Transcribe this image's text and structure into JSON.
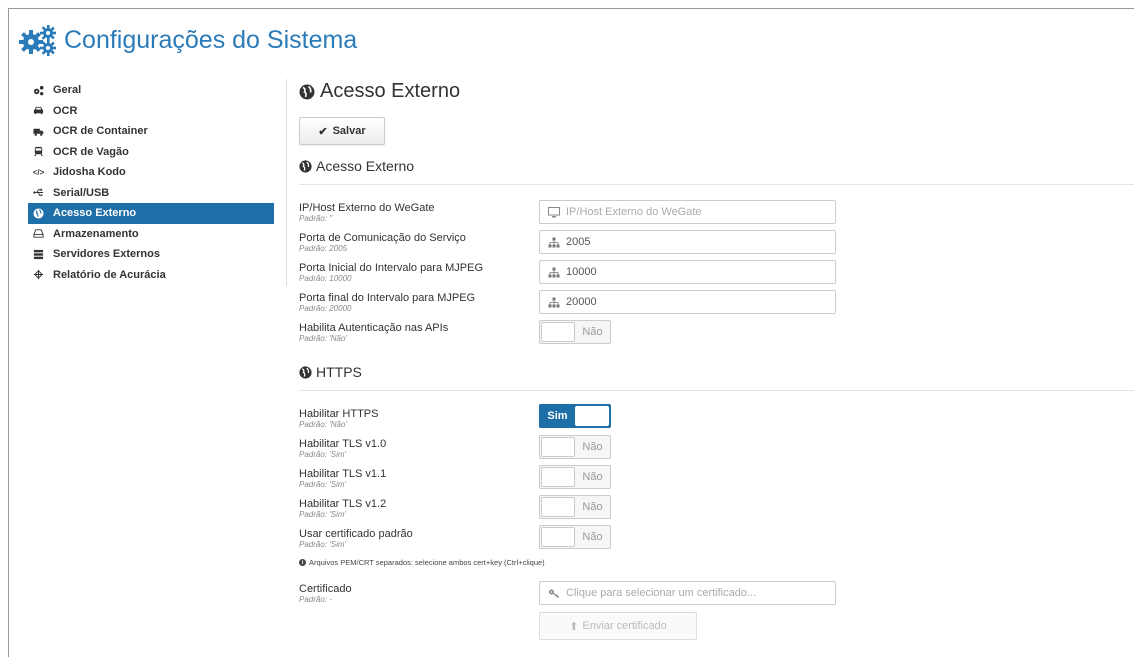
{
  "page": {
    "title": "Configurações do Sistema"
  },
  "sidebar": {
    "items": [
      {
        "label": "Geral",
        "icon": "gears-icon",
        "active": false
      },
      {
        "label": "OCR",
        "icon": "car-icon",
        "active": false
      },
      {
        "label": "OCR de Container",
        "icon": "truck-icon",
        "active": false
      },
      {
        "label": "OCR de Vagão",
        "icon": "train-icon",
        "active": false
      },
      {
        "label": "Jidosha Kodo",
        "icon": "code-icon",
        "active": false
      },
      {
        "label": "Serial/USB",
        "icon": "usb-icon",
        "active": false
      },
      {
        "label": "Acesso Externo",
        "icon": "globe-icon",
        "active": true
      },
      {
        "label": "Armazenamento",
        "icon": "hdd-icon",
        "active": false
      },
      {
        "label": "Servidores Externos",
        "icon": "server-icon",
        "active": false
      },
      {
        "label": "Relatório de Acurácia",
        "icon": "crosshair-icon",
        "active": false
      }
    ]
  },
  "main": {
    "title": "Acesso Externo",
    "save_label": "Salvar",
    "section_external": {
      "title": "Acesso Externo",
      "fields": [
        {
          "label": "IP/Host Externo do WeGate",
          "default": "Padrão: ''",
          "value": "",
          "placeholder": "IP/Host Externo do WeGate",
          "icon": "monitor-icon"
        },
        {
          "label": "Porta de Comunicação do Serviço",
          "default": "Padrão: 2005",
          "value": "2005",
          "icon": "sitemap-icon"
        },
        {
          "label": "Porta Inicial do Intervalo para MJPEG",
          "default": "Padrão: 10000",
          "value": "10000",
          "icon": "sitemap-icon"
        },
        {
          "label": "Porta final do Intervalo para MJPEG",
          "default": "Padrão: 20000",
          "value": "20000",
          "icon": "sitemap-icon"
        }
      ],
      "auth": {
        "label": "Habilita Autenticação nas APIs",
        "default": "Padrão: 'Não'",
        "state": "Não"
      }
    },
    "section_https": {
      "title": "HTTPS",
      "toggles": [
        {
          "label": "Habilitar HTTPS",
          "default": "Padrão: 'Não'",
          "state": "Sim",
          "on": true
        },
        {
          "label": "Habilitar TLS v1.0",
          "default": "Padrão: 'Sim'",
          "state": "Não",
          "on": false
        },
        {
          "label": "Habilitar TLS v1.1",
          "default": "Padrão: 'Sim'",
          "state": "Não",
          "on": false
        },
        {
          "label": "Habilitar TLS v1.2",
          "default": "Padrão: 'Sim'",
          "state": "Não",
          "on": false
        },
        {
          "label": "Usar certificado padrão",
          "default": "Padrão: 'Sim'",
          "state": "Não",
          "on": false
        }
      ],
      "note": "Arquivos PEM/CRT separados: selecione ambos cert+key (Ctrl+clique)",
      "certificate": {
        "label": "Certificado",
        "default": "Padrão: -",
        "placeholder": "Clique para selecionar um certificado..."
      },
      "upload_label": "Enviar certificado"
    }
  },
  "colors": {
    "accent": "#1e6ea8",
    "title": "#2b7bb9"
  }
}
